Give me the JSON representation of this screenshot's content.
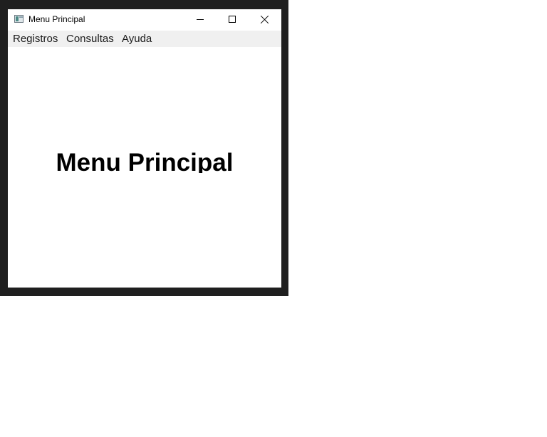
{
  "window": {
    "title": "Menu Principal",
    "app_icon": "window-app-icon",
    "controls": {
      "minimize_icon": "minimize-icon",
      "maximize_icon": "maximize-icon",
      "close_icon": "close-icon"
    }
  },
  "menubar": {
    "items": [
      {
        "label": "Registros"
      },
      {
        "label": "Consultas"
      },
      {
        "label": "Ayuda"
      }
    ]
  },
  "main": {
    "heading": "Menu Principal"
  },
  "colors": {
    "frame": "#1f1f1f",
    "menubar_bg": "#f0f0f0",
    "window_bg": "#ffffff"
  }
}
